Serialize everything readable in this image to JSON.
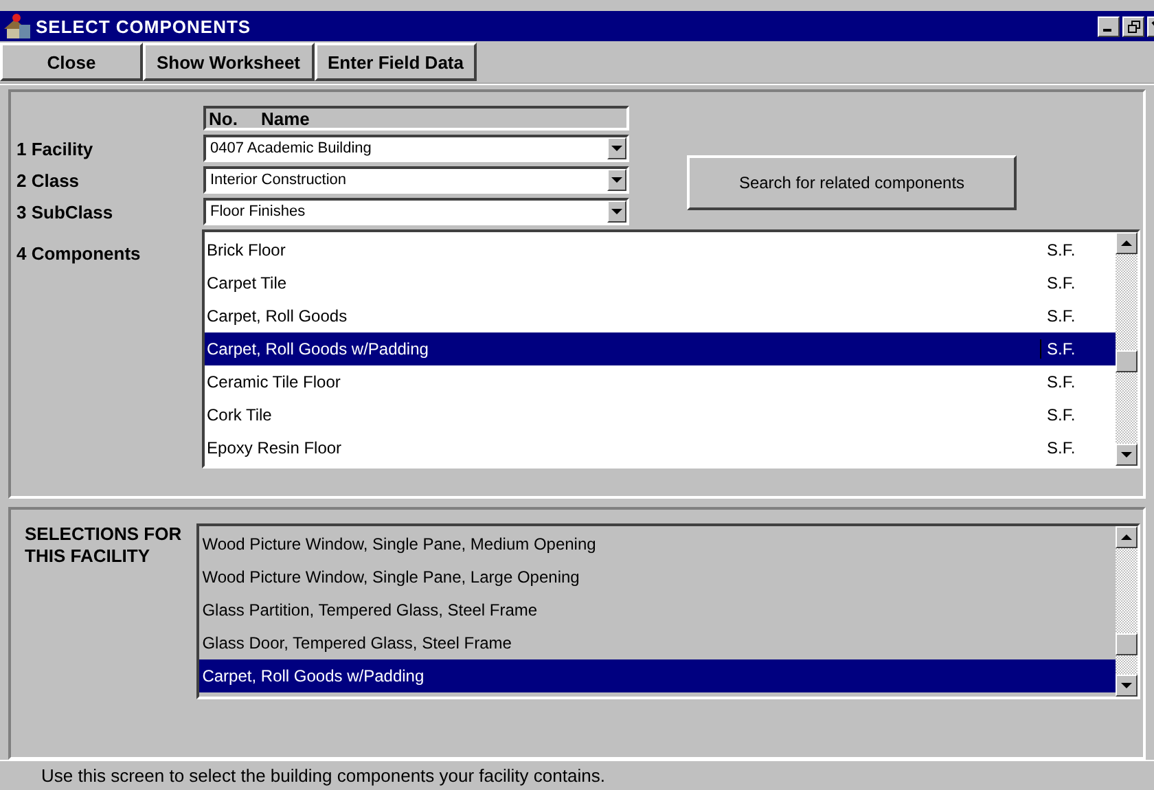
{
  "window": {
    "title": "SELECT COMPONENTS"
  },
  "toolbar": [
    "Close",
    "Show Worksheet",
    "Enter Field Data"
  ],
  "header": {
    "column_1": "No.",
    "column_2": "Name"
  },
  "fields": [
    {
      "label": "1 Facility",
      "value": "0407  Academic Building"
    },
    {
      "label": "2 Class",
      "value": "Interior Construction"
    },
    {
      "label": "3 SubClass",
      "value": "Floor Finishes"
    }
  ],
  "search_button": "Search for related components",
  "components": {
    "label": "4 Components",
    "rows": [
      {
        "name": "Brick Floor",
        "unit": "S.F.",
        "selected": false
      },
      {
        "name": "Carpet Tile",
        "unit": "S.F.",
        "selected": false
      },
      {
        "name": "Carpet, Roll Goods",
        "unit": "S.F.",
        "selected": false
      },
      {
        "name": "Carpet, Roll Goods w/Padding",
        "unit": "S.F.",
        "selected": true
      },
      {
        "name": "Ceramic Tile Floor",
        "unit": "S.F.",
        "selected": false
      },
      {
        "name": "Cork Tile",
        "unit": "S.F.",
        "selected": false
      },
      {
        "name": "Epoxy Resin Floor",
        "unit": "S.F.",
        "selected": false
      }
    ]
  },
  "selections": {
    "label": "SELECTIONS FOR THIS FACILITY",
    "rows": [
      {
        "name": "Wood Picture Window, Single Pane, Medium Opening",
        "selected": false
      },
      {
        "name": "Wood Picture Window, Single Pane, Large Opening",
        "selected": false
      },
      {
        "name": "Glass Partition, Tempered Glass, Steel Frame",
        "selected": false
      },
      {
        "name": "Glass Door, Tempered Glass, Steel Frame",
        "selected": false
      },
      {
        "name": "Carpet, Roll Goods w/Padding",
        "selected": true
      }
    ]
  },
  "status_bar": "Use this screen to select the building components your facility contains."
}
